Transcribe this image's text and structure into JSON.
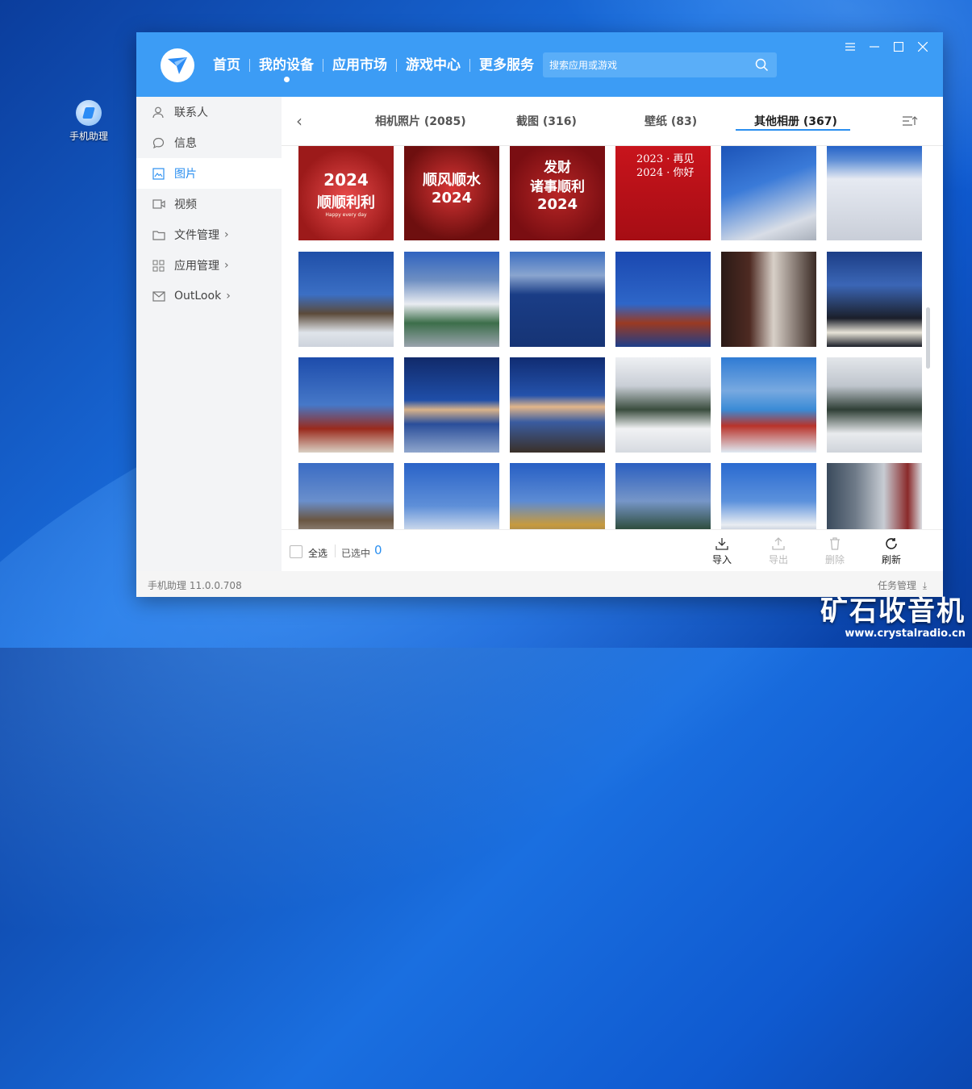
{
  "desktop": {
    "icon_label": "手机助理"
  },
  "app": {
    "nav": [
      "首页",
      "我的设备",
      "应用市场",
      "游戏中心",
      "更多服务"
    ],
    "search_placeholder": "搜索应用或游戏",
    "version": "手机助理 11.0.0.708",
    "task_manager": "任务管理"
  },
  "sidebar": {
    "items": [
      {
        "label": "联系人",
        "icon": "person-icon"
      },
      {
        "label": "信息",
        "icon": "chat-icon"
      },
      {
        "label": "图片",
        "icon": "image-icon"
      },
      {
        "label": "视频",
        "icon": "video-icon"
      },
      {
        "label": "文件管理",
        "icon": "folder-icon"
      },
      {
        "label": "应用管理",
        "icon": "apps-icon"
      },
      {
        "label": "OutLook",
        "icon": "mail-icon"
      }
    ]
  },
  "tabs": [
    "相机照片 (2085)",
    "截图 (316)",
    "壁纸 (83)",
    "其他相册 (367)"
  ],
  "photos": {
    "banner_texts": [
      "2024",
      "顺顺利利",
      "顺风顺水",
      "2024",
      "发财",
      "诸事顺利",
      "2024",
      "2023 · 再见",
      "2024 · 你好",
      "Happy every day"
    ]
  },
  "bottom": {
    "select_all": "全选",
    "selected_label": "已选中",
    "selected_count": "0",
    "actions": [
      "导入",
      "导出",
      "删除",
      "刷新"
    ]
  },
  "brand": {
    "name": "矿石收音机",
    "url": "www.crystalradio.cn"
  },
  "colors": {
    "header": "#3c9cf5",
    "accent": "#2b8ff0"
  }
}
